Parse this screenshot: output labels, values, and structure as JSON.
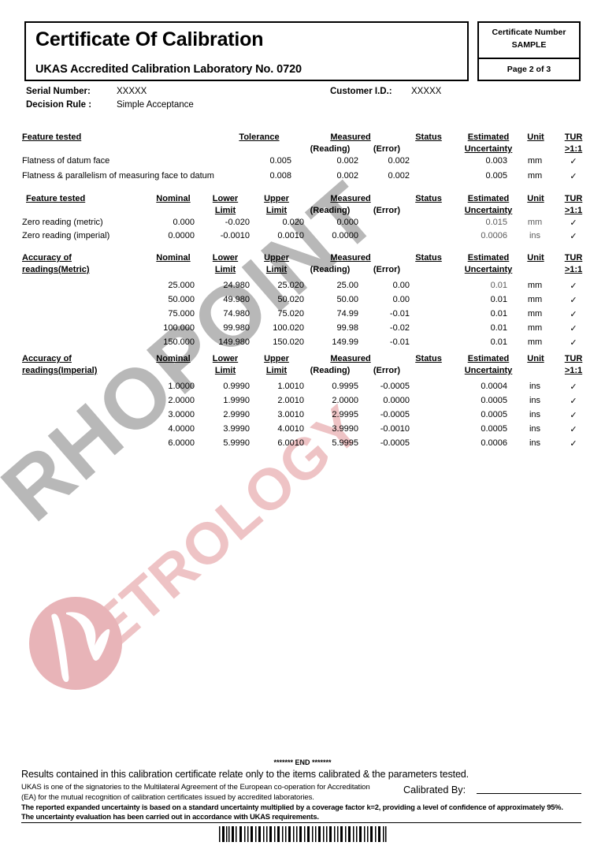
{
  "header": {
    "title": "Certificate Of Calibration",
    "subtitle": "UKAS Accredited Calibration Laboratory No. 0720",
    "certificate_number_label": "Certificate Number",
    "certificate_number_value": "SAMPLE",
    "page_label": "Page 2 of 3"
  },
  "meta": {
    "serial_label": "Serial Number:",
    "serial_value": "XXXXX",
    "customer_label": "Customer I.D.:",
    "customer_value": "XXXXX",
    "decision_label": "Decision Rule :",
    "decision_value": "Simple Acceptance"
  },
  "columns": {
    "feature": "Feature tested",
    "tolerance": "Tolerance",
    "nominal": "Nominal",
    "lower": "Lower",
    "limit": "Limit",
    "upper": "Upper",
    "measured": "Measured",
    "reading": "(Reading)",
    "error": "(Error)",
    "status": "Status",
    "estimated": "Estimated",
    "uncertainty": "Uncertainty",
    "unit": "Unit",
    "tur": "TUR",
    "tur_ratio": ">1:1"
  },
  "section_flatness": {
    "rows": [
      {
        "feature": "Flatness of datum face",
        "tolerance": "0.005",
        "reading": "0.002",
        "error": "0.002",
        "status": "",
        "uncertainty": "0.003",
        "unit": "mm",
        "tur": "✓"
      },
      {
        "feature": "Flatness & parallelism of measuring face to datum",
        "tolerance": "0.008",
        "reading": "0.002",
        "error": "0.002",
        "status": "",
        "uncertainty": "0.005",
        "unit": "mm",
        "tur": "✓"
      }
    ]
  },
  "section_zero": {
    "rows": [
      {
        "feature": "Zero reading (metric)",
        "nominal": "0.000",
        "lower": "-0.020",
        "upper": "0.020",
        "reading": "0.000",
        "error": "",
        "status": "",
        "uncertainty": "0.015",
        "unit": "mm",
        "tur": "✓"
      },
      {
        "feature": "Zero reading (imperial)",
        "nominal": "0.0000",
        "lower": "-0.0010",
        "upper": "0.0010",
        "reading": "0.0000",
        "error": "",
        "status": "",
        "uncertainty": "0.0006",
        "unit": "ins",
        "tur": "✓"
      }
    ]
  },
  "section_metric": {
    "title_line1": "Accuracy of",
    "title_line2": "readings(Metric)",
    "rows": [
      {
        "nominal": "25.000",
        "lower": "24.980",
        "upper": "25.020",
        "reading": "25.00",
        "error": "0.00",
        "status": "",
        "uncertainty": "0.01",
        "unit": "mm",
        "tur": "✓"
      },
      {
        "nominal": "50.000",
        "lower": "49.980",
        "upper": "50.020",
        "reading": "50.00",
        "error": "0.00",
        "status": "",
        "uncertainty": "0.01",
        "unit": "mm",
        "tur": "✓"
      },
      {
        "nominal": "75.000",
        "lower": "74.980",
        "upper": "75.020",
        "reading": "74.99",
        "error": "-0.01",
        "status": "",
        "uncertainty": "0.01",
        "unit": "mm",
        "tur": "✓"
      },
      {
        "nominal": "100.000",
        "lower": "99.980",
        "upper": "100.020",
        "reading": "99.98",
        "error": "-0.02",
        "status": "",
        "uncertainty": "0.01",
        "unit": "mm",
        "tur": "✓"
      },
      {
        "nominal": "150.000",
        "lower": "149.980",
        "upper": "150.020",
        "reading": "149.99",
        "error": "-0.01",
        "status": "",
        "uncertainty": "0.01",
        "unit": "mm",
        "tur": "✓"
      }
    ]
  },
  "section_imperial": {
    "title_line1": "Accuracy of",
    "title_line2": "readings(Imperial)",
    "rows": [
      {
        "nominal": "1.0000",
        "lower": "0.9990",
        "upper": "1.0010",
        "reading": "0.9995",
        "error": "-0.0005",
        "status": "",
        "uncertainty": "0.0004",
        "unit": "ins",
        "tur": "✓"
      },
      {
        "nominal": "2.0000",
        "lower": "1.9990",
        "upper": "2.0010",
        "reading": "2.0000",
        "error": "0.0000",
        "status": "",
        "uncertainty": "0.0005",
        "unit": "ins",
        "tur": "✓"
      },
      {
        "nominal": "3.0000",
        "lower": "2.9990",
        "upper": "3.0010",
        "reading": "2.9995",
        "error": "-0.0005",
        "status": "",
        "uncertainty": "0.0005",
        "unit": "ins",
        "tur": "✓"
      },
      {
        "nominal": "4.0000",
        "lower": "3.9990",
        "upper": "4.0010",
        "reading": "3.9990",
        "error": "-0.0010",
        "status": "",
        "uncertainty": "0.0005",
        "unit": "ins",
        "tur": "✓"
      },
      {
        "nominal": "6.0000",
        "lower": "5.9990",
        "upper": "6.0010",
        "reading": "5.9995",
        "error": "-0.0005",
        "status": "",
        "uncertainty": "0.0006",
        "unit": "ins",
        "tur": "✓"
      }
    ]
  },
  "watermark": {
    "text_primary": "RHOPOINT",
    "text_secondary": "METROLOGY",
    "color_primary": "#b8b8b8",
    "color_secondary": "#eec3c5",
    "logo_color": "#e8b4b8"
  },
  "footer": {
    "end_marker": "******* END *******",
    "line1": "Results contained in this calibration certificate relate only to the items calibrated & the parameters tested.",
    "line2": "UKAS is one of the signatories to the Multilateral Agreement of the European co-operation for Accreditation",
    "line3": "(EA) for the mutual recognition of calibration certificates issued by accredited laboratories.",
    "line4": "The reported expanded uncertainty is based on a standard uncertainty multiplied by a coverage factor k=2, providing a level  of confidence of approximately 95%.",
    "line5": "The uncertainty evaluation has been carried out in accordance with UKAS requirements.",
    "calibrated_by": "Calibrated By:"
  }
}
